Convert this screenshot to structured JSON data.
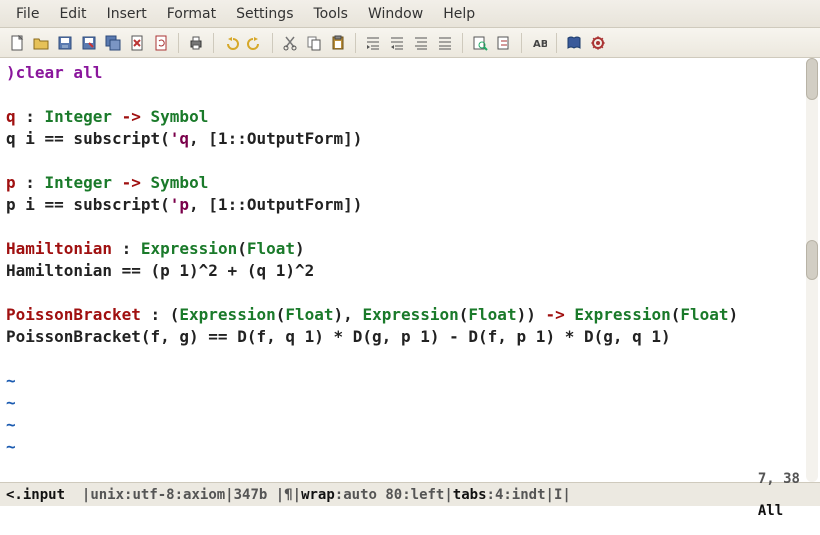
{
  "menubar": {
    "items": [
      "File",
      "Edit",
      "Insert",
      "Format",
      "Settings",
      "Tools",
      "Window",
      "Help"
    ]
  },
  "toolbar": {
    "icons": [
      {
        "name": "new-icon"
      },
      {
        "name": "open-icon"
      },
      {
        "name": "save-icon"
      },
      {
        "name": "save-as-icon"
      },
      {
        "name": "save-all-icon"
      },
      {
        "name": "close-icon"
      },
      {
        "name": "reload-icon"
      },
      {
        "name": "sep"
      },
      {
        "name": "print-icon"
      },
      {
        "name": "sep"
      },
      {
        "name": "undo-icon"
      },
      {
        "name": "redo-icon"
      },
      {
        "name": "sep"
      },
      {
        "name": "cut-icon"
      },
      {
        "name": "copy-icon"
      },
      {
        "name": "paste-icon"
      },
      {
        "name": "sep"
      },
      {
        "name": "indent-icon"
      },
      {
        "name": "outdent-icon"
      },
      {
        "name": "comment-icon"
      },
      {
        "name": "uncomment-icon"
      },
      {
        "name": "sep"
      },
      {
        "name": "find-icon"
      },
      {
        "name": "find-replace-icon"
      },
      {
        "name": "sep"
      },
      {
        "name": "goto-icon"
      },
      {
        "name": "sep"
      },
      {
        "name": "book-icon"
      },
      {
        "name": "gear-icon"
      }
    ]
  },
  "code": {
    "lines": [
      [
        {
          "t": "tk-cmd",
          "v": ")clear all"
        }
      ],
      [],
      [
        {
          "t": "tk-kw",
          "v": "q"
        },
        {
          "t": "",
          "v": " : "
        },
        {
          "t": "tk-type",
          "v": "Integer"
        },
        {
          "t": "",
          "v": " "
        },
        {
          "t": "tk-op",
          "v": "->"
        },
        {
          "t": "",
          "v": " "
        },
        {
          "t": "tk-type",
          "v": "Symbol"
        }
      ],
      [
        {
          "t": "",
          "v": "q i == subscript("
        },
        {
          "t": "tk-str",
          "v": "'q"
        },
        {
          "t": "",
          "v": ", [1::OutputForm])"
        }
      ],
      [],
      [
        {
          "t": "tk-kw",
          "v": "p"
        },
        {
          "t": "",
          "v": " : "
        },
        {
          "t": "tk-type",
          "v": "Integer"
        },
        {
          "t": "",
          "v": " "
        },
        {
          "t": "tk-op",
          "v": "->"
        },
        {
          "t": "",
          "v": " "
        },
        {
          "t": "tk-type",
          "v": "Symbol"
        }
      ],
      [
        {
          "t": "",
          "v": "p i == subscript("
        },
        {
          "t": "tk-str",
          "v": "'p"
        },
        {
          "t": "",
          "v": ", [1::OutputForm])"
        }
      ],
      [],
      [
        {
          "t": "tk-kw",
          "v": "Hamiltonian"
        },
        {
          "t": "",
          "v": " : "
        },
        {
          "t": "tk-type",
          "v": "Expression"
        },
        {
          "t": "",
          "v": "("
        },
        {
          "t": "tk-type",
          "v": "Float"
        },
        {
          "t": "",
          "v": ")"
        }
      ],
      [
        {
          "t": "",
          "v": "Hamiltonian == (p 1)^2 + (q 1)^2"
        }
      ],
      [],
      [
        {
          "t": "tk-kw",
          "v": "PoissonBracket"
        },
        {
          "t": "",
          "v": " : ("
        },
        {
          "t": "tk-type",
          "v": "Expression"
        },
        {
          "t": "",
          "v": "("
        },
        {
          "t": "tk-type",
          "v": "Float"
        },
        {
          "t": "",
          "v": "), "
        },
        {
          "t": "tk-type",
          "v": "Expression"
        },
        {
          "t": "",
          "v": "("
        },
        {
          "t": "tk-type",
          "v": "Float"
        },
        {
          "t": "",
          "v": ")) "
        },
        {
          "t": "tk-op",
          "v": "->"
        },
        {
          "t": "",
          "v": " "
        },
        {
          "t": "tk-type",
          "v": "Expression"
        },
        {
          "t": "",
          "v": "("
        },
        {
          "t": "tk-type",
          "v": "Float"
        },
        {
          "t": "",
          "v": ")"
        }
      ],
      [
        {
          "t": "",
          "v": "PoissonBracket(f, g) == D(f, q 1) * D(g, p 1) - D(f, p 1) * D(g, q 1)"
        }
      ],
      [],
      [
        {
          "t": "tk-tilde",
          "v": "~"
        }
      ],
      [
        {
          "t": "tk-tilde",
          "v": "~"
        }
      ],
      [
        {
          "t": "tk-tilde",
          "v": "~"
        }
      ],
      [
        {
          "t": "tk-tilde",
          "v": "~"
        }
      ]
    ]
  },
  "status": {
    "filetype": "<.input",
    "enc": "unix:utf-8:axiom",
    "size": "347b",
    "pilcrow": "¶",
    "wrap_label": "wrap",
    "wrap_val": ":auto 80:left",
    "tabs_label": "tabs",
    "tabs_val": ":4:indt",
    "mode": "I",
    "line_col": "7, 38",
    "pos": "All"
  }
}
